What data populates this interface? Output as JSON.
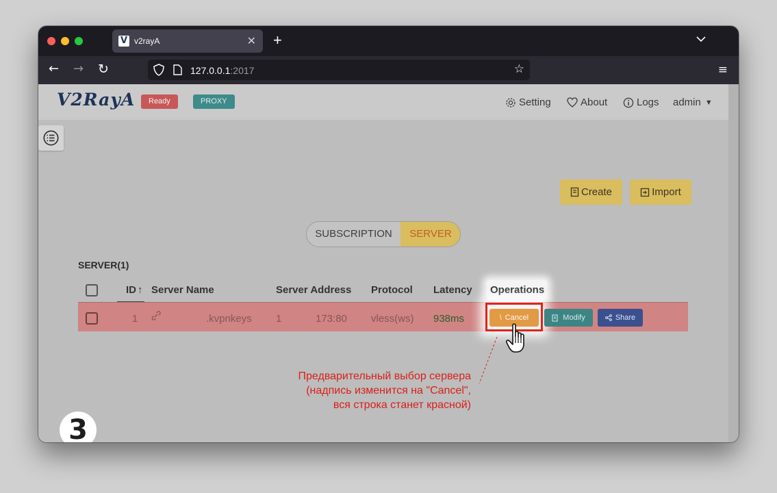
{
  "browser": {
    "tab_title": "v2rayA",
    "tab_favicon_letter": "V",
    "url_host": "127.0.0.1",
    "url_port": ":2017"
  },
  "app": {
    "logo": "V2RayA",
    "status_ready": "Ready",
    "status_proxy": "PROXY",
    "menu": {
      "setting": "Setting",
      "about": "About",
      "logs": "Logs",
      "admin": "admin"
    },
    "actions": {
      "create": "Create",
      "import": "Import"
    },
    "tabs": {
      "subscription": "SUBSCRIPTION",
      "server": "SERVER",
      "active": "server"
    },
    "section_title": "SERVER(1)",
    "table": {
      "headers": {
        "id": "ID",
        "server_name": "Server Name",
        "server_address": "Server Address",
        "protocol": "Protocol",
        "latency": "Latency",
        "operations": "Operations"
      },
      "rows": [
        {
          "id": "1",
          "server_name": ".kvpnkeys",
          "address_prefix": "1",
          "address_port": "173:80",
          "protocol": "vless(ws)",
          "latency": "938ms",
          "selected": true
        }
      ],
      "row_actions": {
        "cancel": "Cancel",
        "modify": "Modify",
        "share": "Share"
      }
    }
  },
  "annotation": {
    "line1": "Предварительный выбор сервера",
    "line2": "(надпись изменится на \"Cancel\",",
    "line3": "вся строка станет красной)",
    "step": "3"
  },
  "colors": {
    "selected_row": "#d08484",
    "highlight_border": "#e0231b",
    "annotation_text": "#d8201b",
    "accent_yellow": "#d9bd5e"
  }
}
